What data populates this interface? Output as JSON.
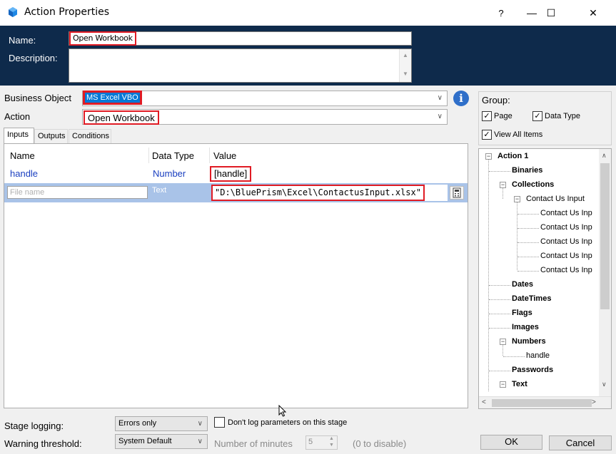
{
  "window": {
    "title": "Action Properties",
    "help": "?",
    "minimize": "—",
    "maximize": "☐",
    "close": "✕"
  },
  "header": {
    "name_label": "Name:",
    "name_value": "Open Workbook",
    "description_label": "Description:",
    "description_value": ""
  },
  "business_object": {
    "label": "Business Object",
    "value": "MS Excel VBO"
  },
  "action": {
    "label": "Action",
    "value": "Open Workbook"
  },
  "info_icon": "i",
  "tabs": [
    "Inputs",
    "Outputs",
    "Conditions"
  ],
  "grid": {
    "columns": [
      "Name",
      "Data Type",
      "Value"
    ],
    "rows": [
      {
        "name": "handle",
        "type": "Number",
        "value": "[handle]"
      },
      {
        "name_placeholder": "File name",
        "type": "Text",
        "value": "\"D:\\BluePrism\\Excel\\ContactusInput.xlsx\""
      }
    ]
  },
  "group": {
    "label": "Group:",
    "page": "Page",
    "data_type": "Data Type",
    "view_all": "View All Items"
  },
  "tree": {
    "action1": "Action 1",
    "binaries": "Binaries",
    "collections": "Collections",
    "contact_us_input": "Contact Us Input",
    "contact_us_inp": [
      "Contact Us Inp",
      "Contact Us Inp",
      "Contact Us Inp",
      "Contact Us Inp",
      "Contact Us Inp"
    ],
    "dates": "Dates",
    "datetimes": "DateTimes",
    "flags": "Flags",
    "images": "Images",
    "numbers": "Numbers",
    "handle": "handle",
    "passwords": "Passwords",
    "text": "Text"
  },
  "bottom": {
    "stage_logging_label": "Stage logging:",
    "stage_logging_value": "Errors only",
    "dont_log_label": "Don't log parameters on this stage",
    "warning_label": "Warning threshold:",
    "warning_value": "System Default",
    "minutes_label": "Number of minutes",
    "minutes_value": "5",
    "disable_hint": "(0 to disable)",
    "ok": "OK",
    "cancel": "Cancel"
  }
}
